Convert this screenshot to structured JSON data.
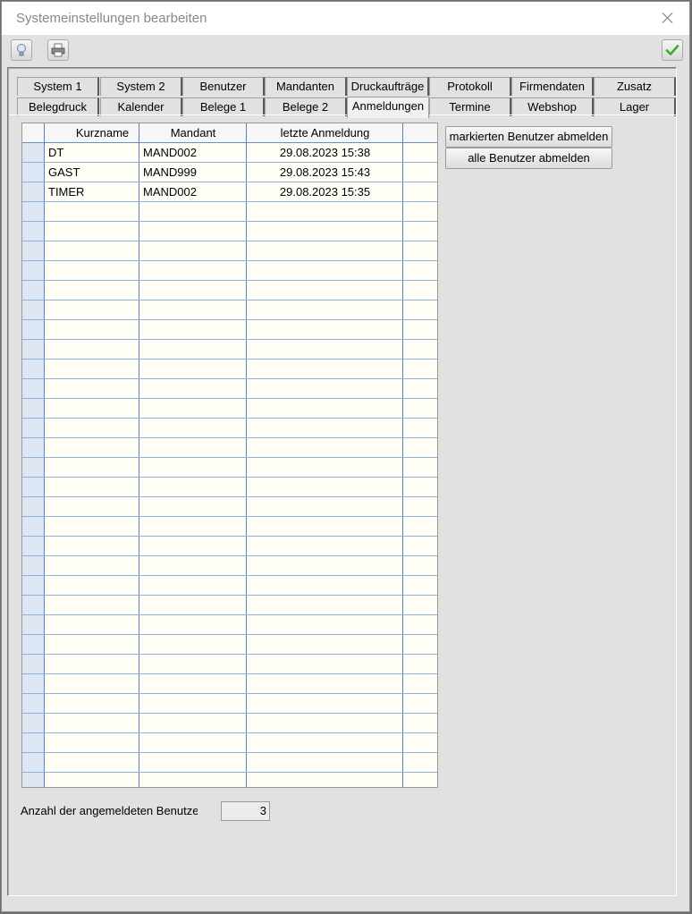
{
  "window": {
    "title": "Systemeinstellungen bearbeiten"
  },
  "toolbar": {
    "icons": {
      "hint": "lightbulb-icon",
      "print": "printer-icon",
      "confirm": "checkmark-icon"
    },
    "confirm_color": "#3fa72f"
  },
  "tabs": {
    "row1": [
      "System 1",
      "System 2",
      "Benutzer",
      "Mandanten",
      "Druckaufträge",
      "Protokoll",
      "Firmendaten",
      "Zusatz"
    ],
    "row2": [
      "Belegdruck",
      "Kalender",
      "Belege 1",
      "Belege 2",
      "Anmeldungen",
      "Termine",
      "Webshop",
      "Lager"
    ],
    "active": "Anmeldungen"
  },
  "grid": {
    "columns": [
      "Kurzname",
      "Mandant",
      "letzte Anmeldung",
      ""
    ],
    "rows": [
      {
        "kurzname": "DT",
        "mandant": "MAND002",
        "anmeldung": "29.08.2023 15:38"
      },
      {
        "kurzname": "GAST",
        "mandant": "MAND999",
        "anmeldung": "29.08.2023 15:43"
      },
      {
        "kurzname": "TIMER",
        "mandant": "MAND002",
        "anmeldung": "29.08.2023 15:35"
      }
    ]
  },
  "buttons": {
    "logout_selected": "markierten Benutzer abmelden",
    "logout_all": "alle Benutzer abmelden"
  },
  "footer": {
    "count_label": "Anzahl der angemeldeten Benutzer",
    "count_value": "3"
  }
}
